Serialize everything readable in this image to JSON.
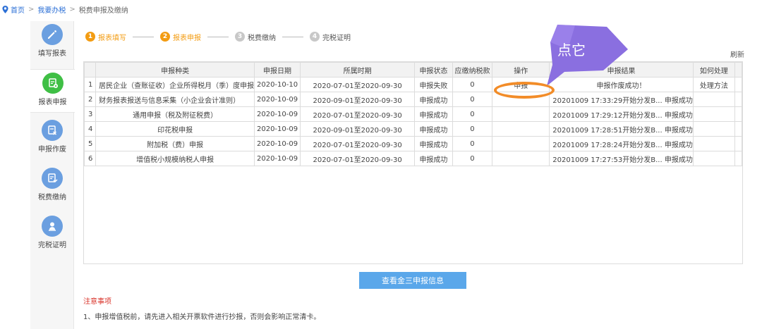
{
  "breadcrumb": {
    "home": "首页",
    "level2": "我要办税",
    "current": "税费申报及缴纳",
    "separator": ">"
  },
  "sidebar": {
    "items": [
      {
        "label": "填写报表",
        "icon": "pencil-icon",
        "color": "#6b9fe0"
      },
      {
        "label": "报表申报",
        "icon": "report-submit-icon",
        "color": "#3fbf45"
      },
      {
        "label": "申报作废",
        "icon": "void-icon",
        "color": "#6b9fe0"
      },
      {
        "label": "税费缴纳",
        "icon": "payment-icon",
        "color": "#6b9fe0"
      },
      {
        "label": "完税证明",
        "icon": "certificate-icon",
        "color": "#6b9fe0"
      }
    ]
  },
  "steps": [
    {
      "num": "1",
      "label": "报表填写",
      "state": "done"
    },
    {
      "num": "2",
      "label": "报表申报",
      "state": "active"
    },
    {
      "num": "3",
      "label": "税费缴纳",
      "state": "pending"
    },
    {
      "num": "4",
      "label": "完税证明",
      "state": "pending"
    }
  ],
  "refresh_label": "刷新",
  "table": {
    "headers": [
      "",
      "申报种类",
      "申报日期",
      "所属时期",
      "申报状态",
      "应缴纳税款",
      "操作",
      "申报结果",
      "如何处理"
    ],
    "rows": [
      {
        "idx": "1",
        "kind": "居民企业（查账征收）企业所得税月（季）度申报",
        "date": "2020-10-10",
        "period": "2020-07-01至2020-09-30",
        "status": "申报失败",
        "tax": "0",
        "op": "申报",
        "result": "申报作废成功！",
        "handle": "处理方法"
      },
      {
        "idx": "2",
        "kind": "财务报表报送与信息采集（小企业会计准则）",
        "date": "2020-10-09",
        "period": "2020-09-01至2020-09-30",
        "status": "申报成功",
        "tax": "0",
        "op": "",
        "result": "20201009 17:33:29开始分发B... 申报成功",
        "handle": ""
      },
      {
        "idx": "3",
        "kind": "通用申报（税及附征税费）",
        "date": "2020-10-09",
        "period": "2020-07-01至2020-09-30",
        "status": "申报成功",
        "tax": "0",
        "op": "",
        "result": "20201009 17:29:12开始分发B... 申报成功",
        "handle": ""
      },
      {
        "idx": "4",
        "kind": "印花税申报",
        "date": "2020-10-09",
        "period": "2020-09-01至2020-09-30",
        "status": "申报成功",
        "tax": "0",
        "op": "",
        "result": "20201009 17:28:51开始分发B... 申报成功",
        "handle": ""
      },
      {
        "idx": "5",
        "kind": "附加税（费）申报",
        "date": "2020-10-09",
        "period": "2020-07-01至2020-09-30",
        "status": "申报成功",
        "tax": "0",
        "op": "",
        "result": "20201009 17:28:24开始分发B... 申报成功",
        "handle": ""
      },
      {
        "idx": "6",
        "kind": "增值税小规模纳税人申报",
        "date": "2020-10-09",
        "period": "2020-07-01至2020-09-30",
        "status": "申报成功",
        "tax": "0",
        "op": "",
        "result": "20201009 17:27:53开始分发B... 申报成功",
        "handle": ""
      }
    ]
  },
  "query_button": "查看金三申报信息",
  "notice": {
    "title": "注意事项",
    "text": "1、申报增值税前，请先进入相关开票软件进行抄报，否则会影响正常清卡。"
  },
  "annotation": {
    "callout_text": "点它",
    "callout_color": "#8a6fe0",
    "highlight_color": "#f28c28"
  }
}
